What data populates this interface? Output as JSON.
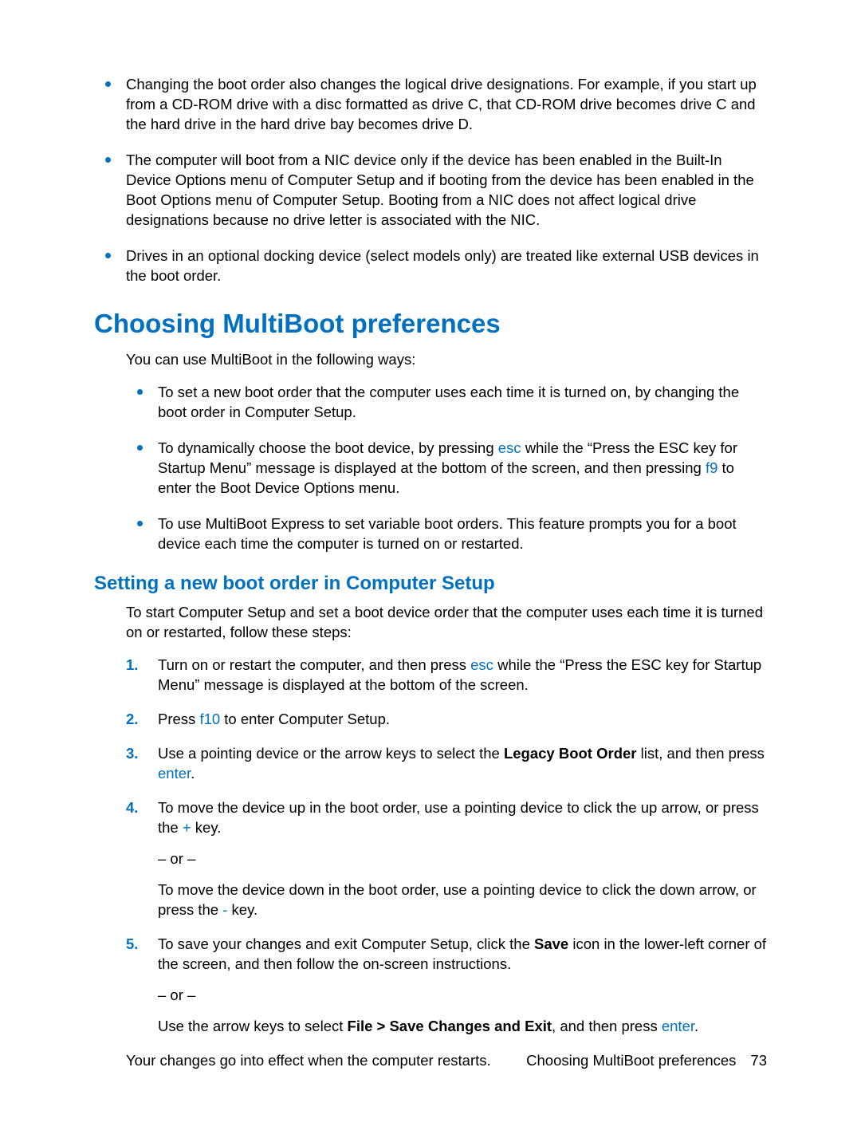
{
  "top_bullets": [
    "Changing the boot order also changes the logical drive designations. For example, if you start up from a CD-ROM drive with a disc formatted as drive C, that CD-ROM drive becomes drive C and the hard drive in the hard drive bay becomes drive D.",
    "The computer will boot from a NIC device only if the device has been enabled in the Built-In Device Options menu of Computer Setup and if booting from the device has been enabled in the Boot Options menu of Computer Setup. Booting from a NIC does not affect logical drive designations because no drive letter is associated with the NIC.",
    "Drives in an optional docking device (select models only) are treated like external USB devices in the boot order."
  ],
  "h1": "Choosing MultiBoot preferences",
  "intro1": "You can use MultiBoot in the following ways:",
  "mid_bullets": {
    "b0": "To set a new boot order that the computer uses each time it is turned on, by changing the boot order in Computer Setup.",
    "b1_a": "To dynamically choose the boot device, by pressing ",
    "b1_key1": "esc",
    "b1_b": " while the “Press the ESC key for Startup Menu” message is displayed at the bottom of the screen, and then pressing ",
    "b1_key2": "f9",
    "b1_c": " to enter the Boot Device Options menu.",
    "b2": "To use MultiBoot Express to set variable boot orders. This feature prompts you for a boot device each time the computer is turned on or restarted."
  },
  "h2": "Setting a new boot order in Computer Setup",
  "intro2": "To start Computer Setup and set a boot device order that the computer uses each time it is turned on or restarted, follow these steps:",
  "steps": {
    "n1": "1.",
    "s1_a": "Turn on or restart the computer, and then press ",
    "s1_key": "esc",
    "s1_b": " while the “Press the ESC key for Startup Menu” message is displayed at the bottom of the screen.",
    "n2": "2.",
    "s2_a": "Press ",
    "s2_key": "f10",
    "s2_b": " to enter Computer Setup.",
    "n3": "3.",
    "s3_a": "Use a pointing device or the arrow keys to select the ",
    "s3_bold": "Legacy Boot Order",
    "s3_b": " list, and then press ",
    "s3_key": "enter",
    "s3_c": ".",
    "n4": "4.",
    "s4_a": "To move the device up in the boot order, use a pointing device to click the up arrow, or press the ",
    "s4_key1": "+",
    "s4_b": " key.",
    "s4_or": "– or –",
    "s4_c": "To move the device down in the boot order, use a pointing device to click the down arrow, or press the ",
    "s4_key2": "-",
    "s4_d": " key.",
    "n5": "5.",
    "s5_a": "To save your changes and exit Computer Setup, click the ",
    "s5_bold1": "Save",
    "s5_b": " icon in the lower-left corner of the screen, and then follow the on-screen instructions.",
    "s5_or": "– or –",
    "s5_c": "Use the arrow keys to select ",
    "s5_bold2": "File > Save Changes and Exit",
    "s5_d": ", and then press ",
    "s5_key": "enter",
    "s5_e": "."
  },
  "closing": "Your changes go into effect when the computer restarts.",
  "footer_label": "Choosing MultiBoot preferences",
  "footer_page": "73"
}
